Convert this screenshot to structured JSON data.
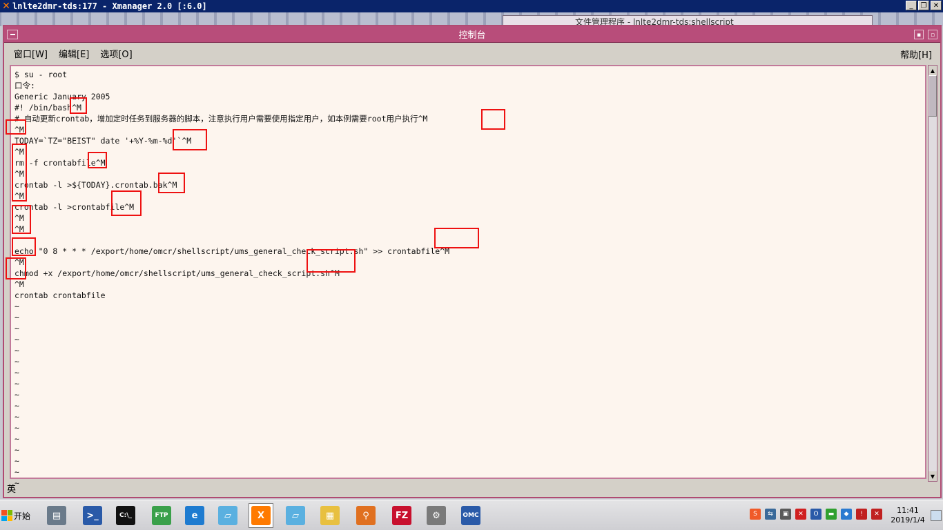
{
  "outer_window": {
    "title": "lnlte2dmr-tds:177 - Xmanager 2.0 [:6.0]"
  },
  "background_window": {
    "title": "文件管理程序 - lnlte2dmr-tds:shellscript"
  },
  "console_window": {
    "title": "控制台",
    "menu": {
      "window": "窗口[W]",
      "edit": "编辑[E]",
      "options": "选项[O]",
      "help": "帮助[H]"
    },
    "terminal_lines": [
      "$ su - root",
      "口令:",
      "Generic January 2005",
      "#! /bin/bash^M",
      "# 自动更新crontab，增加定时任务到服务器的脚本，注意执行用户需要使用指定用户，如本例需要root用户执行^M",
      "^M",
      "TODAY=`TZ=\"BEIST\" date '+%Y-%m-%d'`^M",
      "^M",
      "rm -f crontabfile^M",
      "^M",
      "crontab -l >${TODAY}.crontab.bak^M",
      "^M",
      "crontab -l >crontabfile^M",
      "^M",
      "^M",
      "",
      "echo \"0 8 * * * /export/home/omcr/shellscript/ums_general_check_script.sh\" >> crontabfile^M",
      "^M",
      "chmod +x /export/home/omcr/shellscript/ums_general_check_script.sh^M",
      "^M",
      "crontab crontabfile",
      "~",
      "~",
      "~",
      "~",
      "~",
      "~",
      "~",
      "~",
      "~",
      "~",
      "~",
      "~",
      "~",
      "~",
      "~",
      "~",
      "~"
    ],
    "ime_indicator": "英"
  },
  "taskbar": {
    "start_label": "开始",
    "apps": [
      {
        "name": "server-manager-icon",
        "glyph": "▤",
        "color": "#6a7a8a"
      },
      {
        "name": "powershell-icon",
        "glyph": ">_",
        "color": "#2a5aa8"
      },
      {
        "name": "cmd-icon",
        "glyph": "C:\\_",
        "color": "#111111"
      },
      {
        "name": "ftp-client-icon",
        "glyph": "FTP",
        "color": "#3aa04a"
      },
      {
        "name": "internet-explorer-icon",
        "glyph": "e",
        "color": "#1e7bd0"
      },
      {
        "name": "notepad-icon",
        "glyph": "▱",
        "color": "#5ab0e0"
      },
      {
        "name": "xmanager-icon",
        "glyph": "X",
        "color": "#ff7a00"
      },
      {
        "name": "notepad2-icon",
        "glyph": "▱",
        "color": "#5ab0e0"
      },
      {
        "name": "file-explorer-icon",
        "glyph": "▦",
        "color": "#e8c040"
      },
      {
        "name": "search-tool-icon",
        "glyph": "⚲",
        "color": "#e07020"
      },
      {
        "name": "filezilla-icon",
        "glyph": "FZ",
        "color": "#c8102e"
      },
      {
        "name": "network-tool-icon",
        "glyph": "⚙",
        "color": "#7a7a7a"
      },
      {
        "name": "omc-icon",
        "glyph": "OMC",
        "color": "#2a5aa8"
      }
    ],
    "tray": [
      {
        "name": "sogou-ime-icon",
        "glyph": "S",
        "color": "#f05a28"
      },
      {
        "name": "network-icon",
        "glyph": "⇆",
        "color": "#3a6a9a"
      },
      {
        "name": "tray-app-icon",
        "glyph": "▣",
        "color": "#5a5a5a"
      },
      {
        "name": "tray-close-icon",
        "glyph": "✕",
        "color": "#d02020"
      },
      {
        "name": "omc-tray-icon",
        "glyph": "O",
        "color": "#2a5aa8"
      },
      {
        "name": "tray-green-icon",
        "glyph": "▬",
        "color": "#30a030"
      },
      {
        "name": "tray-blue-icon",
        "glyph": "◆",
        "color": "#2a7ad0"
      },
      {
        "name": "tray-warning-icon",
        "glyph": "!",
        "color": "#c02020"
      },
      {
        "name": "volume-muted-icon",
        "glyph": "✕",
        "color": "#c02020"
      }
    ],
    "clock_time": "11:41",
    "clock_date": "2019/1/4"
  }
}
